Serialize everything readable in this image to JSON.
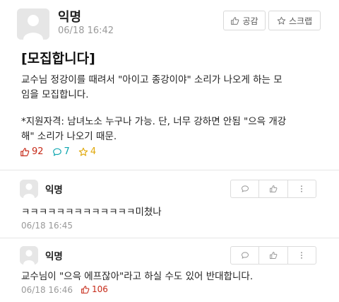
{
  "post": {
    "author": "익명",
    "date": "06/18 16:42",
    "like_button": "공감",
    "scrap_button": "스크랩",
    "title": "[모집합니다]",
    "paragraph1": "교수님 정강이를 때려서 \"아이고 종강이야\" 소리가 나오게 하는 모\n임을 모집합니다.",
    "paragraph2": "*지원자격: 남녀노소 누구나 가능. 단, 너무 강하면 안됨 \"으윽 개강\n해\" 소리가 나오기 때문.",
    "likes": "92",
    "comments": "7",
    "scraps": "4"
  },
  "comments": [
    {
      "author": "익명",
      "text": "ㅋㅋㅋㅋㅋㅋㅋㅋㅋㅋㅋㅋㅋ미쳤나",
      "date": "06/18 16:45"
    },
    {
      "author": "익명",
      "text": "교수님이 \"으윽 에프잖아\"라고 하실 수도 있어 반대합니다.",
      "date": "06/18 16:46",
      "likes": "106"
    }
  ],
  "colors": {
    "like": "#c62917",
    "comment": "#0ca5af",
    "scrap": "#e0a80b"
  },
  "icons": {
    "like": "thumbs-up-icon",
    "comment": "speech-bubble-icon",
    "scrap": "star-icon",
    "reply": "speech-bubble-icon",
    "more": "vertical-dots-icon"
  }
}
